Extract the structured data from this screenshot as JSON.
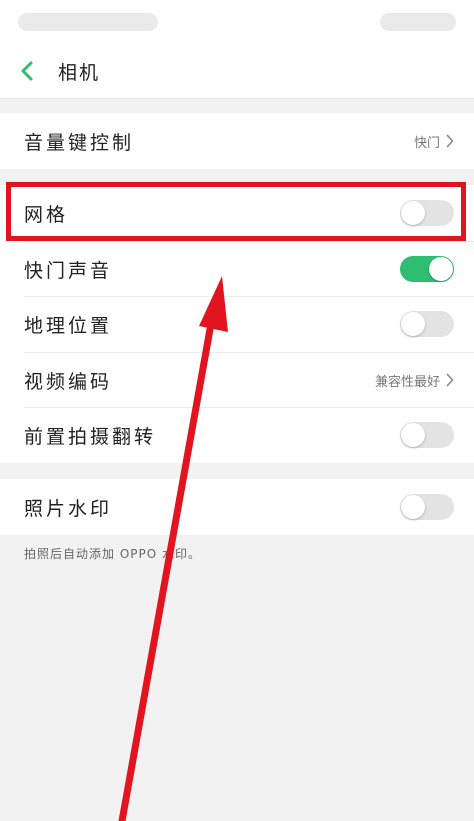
{
  "header": {
    "title": "相机"
  },
  "settings": {
    "volume_key": {
      "label": "音量键控制",
      "value": "快门"
    },
    "grid": {
      "label": "网格",
      "enabled": false
    },
    "shutter_sound": {
      "label": "快门声音",
      "enabled": true
    },
    "location": {
      "label": "地理位置",
      "enabled": false
    },
    "video_encoding": {
      "label": "视频编码",
      "value": "兼容性最好"
    },
    "front_mirror": {
      "label": "前置拍摄翻转",
      "enabled": false
    },
    "watermark": {
      "label": "照片水印",
      "enabled": false,
      "hint": "拍照后自动添加 OPPO 水印。"
    }
  },
  "colors": {
    "toggle_on": "#2ebd71",
    "toggle_off": "#e3e3e3",
    "accent_back": "#2ebd71",
    "annotation_red": "#e2141f"
  },
  "icons": {
    "back": "chevron-left-icon",
    "disclosure": "chevron-right-icon"
  }
}
